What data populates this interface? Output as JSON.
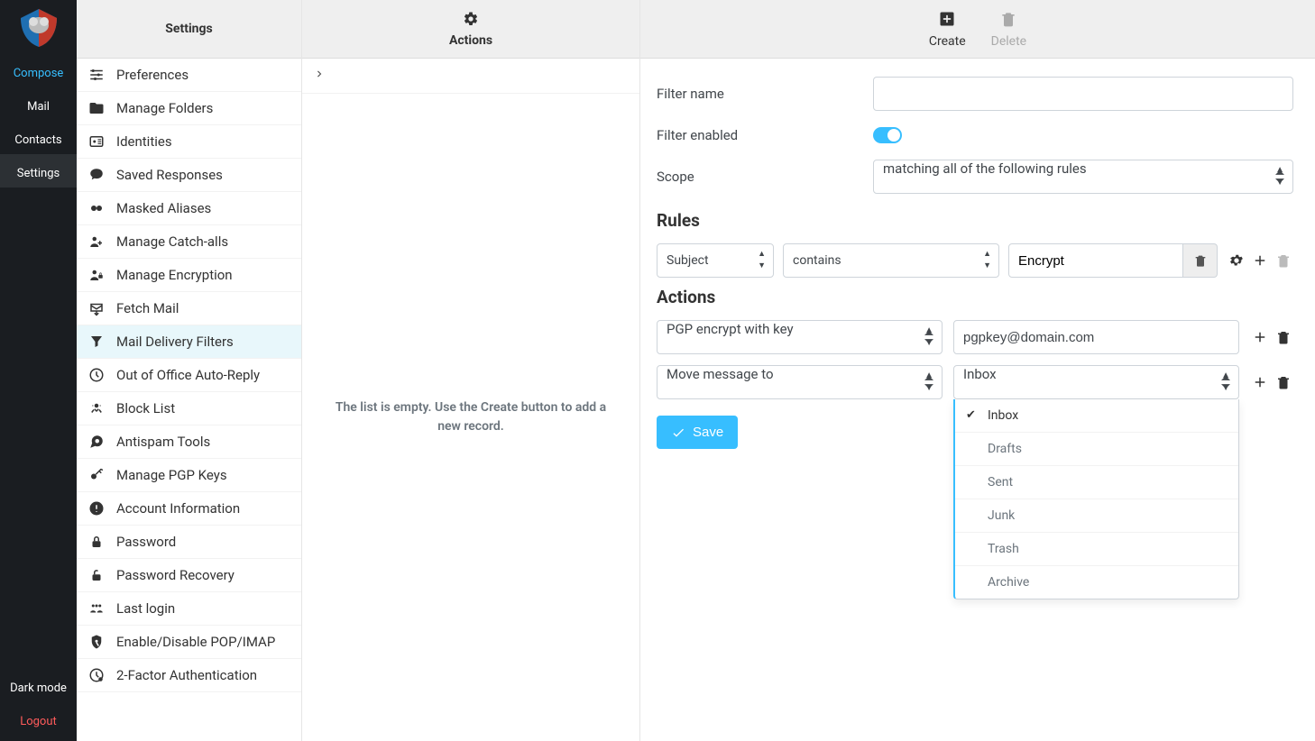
{
  "rail": {
    "compose": "Compose",
    "mail": "Mail",
    "contacts": "Contacts",
    "settings": "Settings",
    "dark": "Dark mode",
    "logout": "Logout"
  },
  "settings_header": "Settings",
  "settings_items": [
    {
      "label": "Preferences"
    },
    {
      "label": "Manage Folders"
    },
    {
      "label": "Identities"
    },
    {
      "label": "Saved Responses"
    },
    {
      "label": "Masked Aliases"
    },
    {
      "label": "Manage Catch-alls"
    },
    {
      "label": "Manage Encryption"
    },
    {
      "label": "Fetch Mail"
    },
    {
      "label": "Mail Delivery Filters",
      "selected": true
    },
    {
      "label": "Out of Office Auto-Reply"
    },
    {
      "label": "Block List"
    },
    {
      "label": "Antispam Tools"
    },
    {
      "label": "Manage PGP Keys"
    },
    {
      "label": "Account Information"
    },
    {
      "label": "Password"
    },
    {
      "label": "Password Recovery"
    },
    {
      "label": "Last login"
    },
    {
      "label": "Enable/Disable POP/IMAP"
    },
    {
      "label": "2-Factor Authentication"
    }
  ],
  "actions_header": "Actions",
  "empty_text": "The list is empty. Use the Create button to add a new record.",
  "form_header": {
    "create": "Create",
    "delete": "Delete"
  },
  "form": {
    "filter_name_label": "Filter name",
    "filter_name_value": "",
    "filter_enabled_label": "Filter enabled",
    "filter_enabled": true,
    "scope_label": "Scope",
    "scope_value": "matching all of the following rules",
    "rules_title": "Rules",
    "rule": {
      "field": "Subject",
      "op": "contains",
      "value": "Encrypt"
    },
    "actions_title": "Actions",
    "action1": {
      "type": "PGP encrypt with key",
      "value": "pgpkey@domain.com"
    },
    "action2": {
      "type": "Move message to",
      "value": "Inbox"
    },
    "folder_options": [
      "Inbox",
      "Drafts",
      "Sent",
      "Junk",
      "Trash",
      "Archive"
    ],
    "save": "Save"
  }
}
